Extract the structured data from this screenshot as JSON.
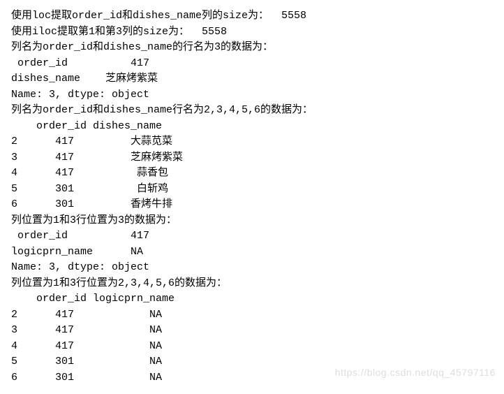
{
  "lines": {
    "l1": "使用loc提取order_id和dishes_name列的size为：  5558",
    "l2": "使用iloc提取第1和第3列的size为：  5558",
    "l3": "列名为order_id和dishes_name的行名为3的数据为：",
    "l4": " order_id          417",
    "l5": "dishes_name    芝麻烤紫菜",
    "l6": "Name: 3, dtype: object",
    "l7": "列名为order_id和dishes_name行名为2,3,4,5,6的数据为：",
    "l8": "    order_id dishes_name",
    "l9": "2      417         大蒜苋菜",
    "l10": "3      417         芝麻烤紫菜",
    "l11": "4      417          蒜香包",
    "l12": "5      301          白斩鸡",
    "l13": "6      301         香烤牛排",
    "l14": "列位置为1和3行位置为3的数据为：",
    "l15": " order_id          417",
    "l16": "logicprn_name      NA",
    "l17": "Name: 3, dtype: object",
    "l18": "列位置为1和3行位置为2,3,4,5,6的数据为：",
    "l19": "    order_id logicprn_name",
    "l20": "2      417            NA",
    "l21": "3      417            NA",
    "l22": "4      417            NA",
    "l23": "5      301            NA",
    "l24": "6      301            NA"
  },
  "watermark": "https://blog.csdn.net/qq_45797116"
}
